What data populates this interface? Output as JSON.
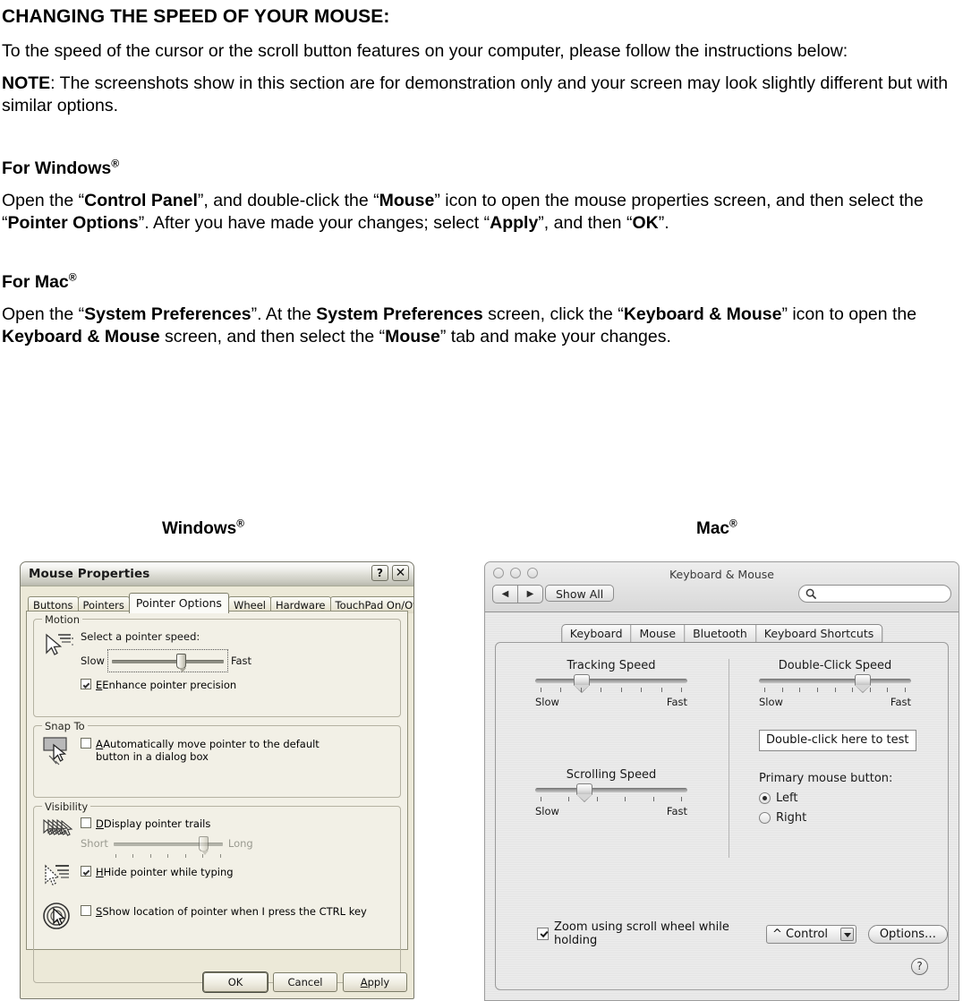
{
  "document": {
    "title": "CHANGING THE SPEED OF YOUR MOUSE:",
    "intro": "To the speed of the cursor or the scroll button features on your computer, please follow the instructions below:",
    "note_label": "NOTE",
    "note_text": ": The screenshots show in this section are for demonstration only and your screen may look slightly different but with similar options.",
    "windows_heading": "For Windows",
    "windows_heading_sup": "®",
    "windows_body": {
      "p1": "Open the “",
      "b1": "Control Panel",
      "p2": "”, and double-click the “",
      "b2": "Mouse",
      "p3": "” icon to open the mouse properties screen, and then select the “",
      "b3": "Pointer Options",
      "p4": "”. After you have made your changes; select “",
      "b4": "Apply",
      "p5": "”, and then “",
      "b5": "OK",
      "p6": "”."
    },
    "mac_heading": "For Mac",
    "mac_heading_sup": "®",
    "mac_body": {
      "p1": "Open the “",
      "b1": "System Preferences",
      "p2": "”. At the ",
      "b2": "System Preferences",
      "p3": " screen, click the “",
      "b3": "Keyboard & Mouse",
      "p4": "” icon to open the ",
      "b4": "Keyboard & Mouse",
      "p5": " screen, and then select the “",
      "b5": "Mouse",
      "p6": "” tab and make your changes."
    },
    "caption_windows": "Windows",
    "caption_windows_sup": "®",
    "caption_mac": "Mac",
    "caption_mac_sup": "®"
  },
  "windows_dialog": {
    "title": "Mouse Properties",
    "help_button": "?",
    "close_button": "✕",
    "tabs": [
      {
        "label": "Buttons",
        "active": false
      },
      {
        "label": "Pointers",
        "active": false
      },
      {
        "label": "Pointer Options",
        "active": true
      },
      {
        "label": "Wheel",
        "active": false
      },
      {
        "label": "Hardware",
        "active": false
      },
      {
        "label": "TouchPad On/Off",
        "active": false
      }
    ],
    "motion": {
      "legend": "Motion",
      "speed_label": "Select a pointer speed:",
      "slow": "Slow",
      "fast": "Fast",
      "slider_percent": 58,
      "enhance_label": "Enhance pointer precision",
      "enhance_checked": true
    },
    "snap_to": {
      "legend": "Snap To",
      "auto_move_label": "Automatically move pointer to the default button in a dialog box",
      "auto_move_checked": false
    },
    "visibility": {
      "legend": "Visibility",
      "trails_label": "Display pointer trails",
      "trails_checked": false,
      "short": "Short",
      "long": "Long",
      "trails_slider_percent": 78,
      "hide_label": "Hide pointer while typing",
      "hide_checked": true,
      "show_location_label": "Show location of pointer when I press the CTRL key",
      "show_location_checked": false
    },
    "buttons": {
      "ok": "OK",
      "cancel": "Cancel",
      "apply": "Apply"
    }
  },
  "mac_window": {
    "title": "Keyboard & Mouse",
    "back_glyph": "◀",
    "forward_glyph": "▶",
    "show_all": "Show All",
    "search_placeholder": "",
    "tabs": [
      {
        "label": "Keyboard"
      },
      {
        "label": "Mouse"
      },
      {
        "label": "Bluetooth"
      },
      {
        "label": "Keyboard Shortcuts"
      }
    ],
    "tracking_speed": {
      "title": "Tracking Speed",
      "slow": "Slow",
      "fast": "Fast",
      "value_percent": 25,
      "tick_count": 8
    },
    "scrolling_speed": {
      "title": "Scrolling Speed",
      "slow": "Slow",
      "fast": "Fast",
      "value_percent": 27,
      "tick_count": 6
    },
    "double_click_speed": {
      "title": "Double-Click Speed",
      "slow": "Slow",
      "fast": "Fast",
      "value_percent": 63,
      "tick_count": 9
    },
    "double_click_test": "Double-click here to test",
    "primary_mouse_button_label": "Primary mouse button:",
    "primary_options": [
      {
        "label": "Left",
        "selected": true
      },
      {
        "label": "Right",
        "selected": false
      }
    ],
    "zoom_row": {
      "checkbox_label": "Zoom using scroll wheel while holding",
      "checked": true,
      "modifier_value": "^ Control",
      "options_button": "Options…"
    },
    "help_button": "?"
  }
}
